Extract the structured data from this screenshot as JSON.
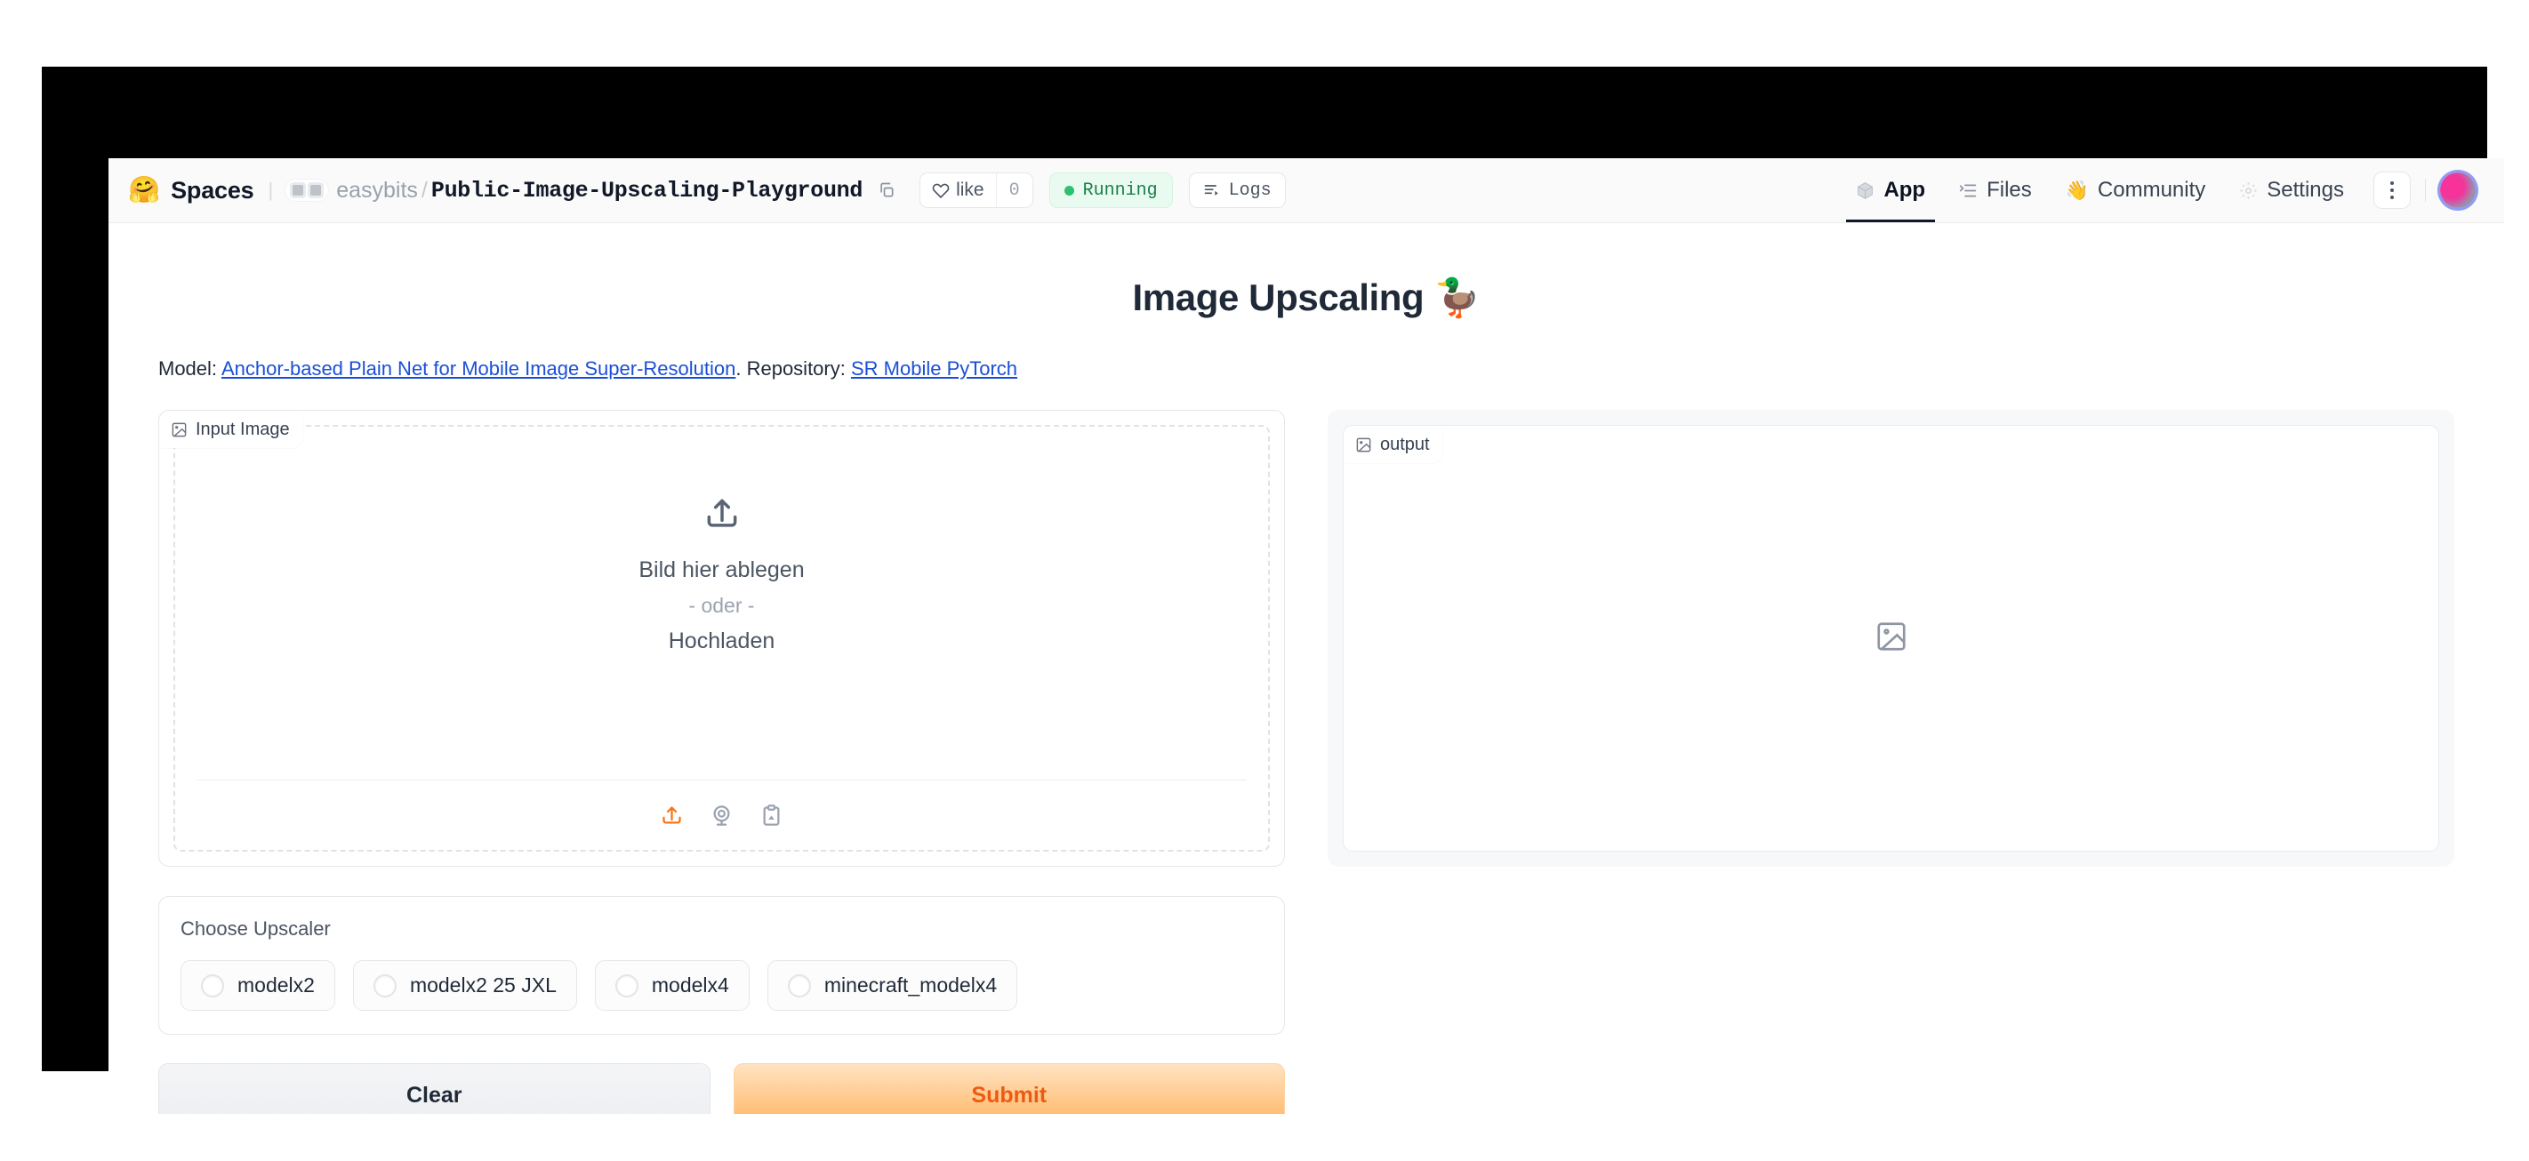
{
  "header": {
    "logo_icon": "hugging-face-icon",
    "spaces_label": "Spaces",
    "org": "easybits",
    "slash": "/",
    "repo": "Public-Image-Upscaling-Playground",
    "copy_icon": "copy-icon",
    "like": {
      "label": "like",
      "icon": "heart-icon",
      "count": "0"
    },
    "status": {
      "label": "Running",
      "dot_color": "#2fbf71"
    },
    "logs": {
      "label": "Logs",
      "icon": "logs-icon"
    },
    "tabs": [
      {
        "label": "App",
        "icon": "cube-icon",
        "active": true
      },
      {
        "label": "Files",
        "icon": "files-icon",
        "active": false
      },
      {
        "label": "Community",
        "icon": "wave-hand-icon",
        "active": false
      },
      {
        "label": "Settings",
        "icon": "gear-icon",
        "active": false
      }
    ],
    "kebab_icon": "kebab-menu-icon",
    "avatar_icon": "user-avatar"
  },
  "app": {
    "title": "Image Upscaling 🦆",
    "model_prefix": "Model: ",
    "model_link": "Anchor-based Plain Net for Mobile Image Super-Resolution",
    "model_mid": ". Repository: ",
    "repo_link": "SR Mobile PyTorch"
  },
  "input_panel": {
    "label": "Input Image",
    "label_icon": "image-icon",
    "upload_icon": "upload-icon",
    "drop_text": "Bild hier ablegen",
    "or_text": "- oder -",
    "upload_text": "Hochladen",
    "tools": [
      {
        "name": "upload-icon",
        "color": "#f97316"
      },
      {
        "name": "webcam-icon",
        "color": "#9ca3af"
      },
      {
        "name": "clipboard-paste-icon",
        "color": "#9ca3af"
      }
    ]
  },
  "output_panel": {
    "label": "output",
    "label_icon": "image-icon",
    "placeholder_icon": "image-placeholder-icon"
  },
  "upscaler": {
    "title": "Choose Upscaler",
    "options": [
      {
        "label": "modelx2",
        "selected": false
      },
      {
        "label": "modelx2 25 JXL",
        "selected": false
      },
      {
        "label": "modelx4",
        "selected": false
      },
      {
        "label": "minecraft_modelx4",
        "selected": false
      }
    ]
  },
  "actions": {
    "clear_label": "Clear",
    "submit_label": "Submit",
    "submit_color": "#ef5a12"
  }
}
